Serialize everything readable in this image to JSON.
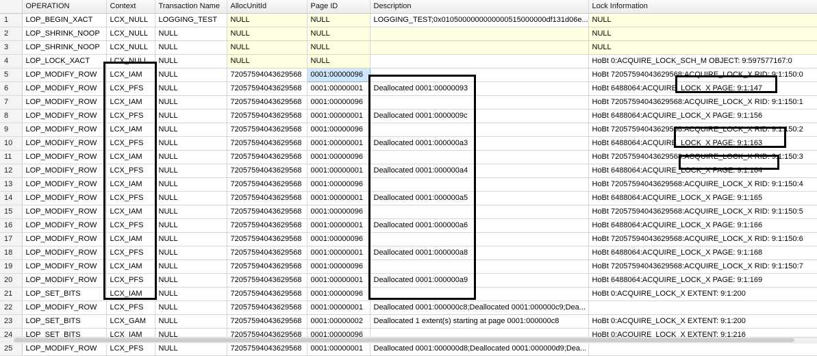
{
  "columns": [
    "",
    "OPERATION",
    "Context",
    "Transaction Name",
    "AllocUnitId",
    "Page ID",
    "Description",
    "Lock Information"
  ],
  "rows": [
    [
      "1",
      "LOP_BEGIN_XACT",
      "LCX_NULL",
      "LOGGING_TEST",
      "NULL",
      "NULL",
      "LOGGING_TEST;0x0105000000000000515000000df131d06e...",
      "NULL"
    ],
    [
      "2",
      "LOP_SHRINK_NOOP",
      "LCX_NULL",
      "NULL",
      "NULL",
      "NULL",
      "",
      "NULL"
    ],
    [
      "3",
      "LOP_SHRINK_NOOP",
      "LCX_NULL",
      "NULL",
      "NULL",
      "NULL",
      "",
      "NULL"
    ],
    [
      "4",
      "LOP_LOCK_XACT",
      "LCX_NULL",
      "NULL",
      "NULL",
      "NULL",
      "",
      "HoBt 0:ACQUIRE_LOCK_SCH_M OBJECT: 9:597577167:0"
    ],
    [
      "5",
      "LOP_MODIFY_ROW",
      "LCX_IAM",
      "NULL",
      "72057594043629568",
      "0001:00000096",
      "",
      "HoBt 72057594043629568:ACQUIRE_LOCK_X RID: 9:1:150:0"
    ],
    [
      "6",
      "LOP_MODIFY_ROW",
      "LCX_PFS",
      "NULL",
      "72057594043629568",
      "0001:00000001",
      "Deallocated 0001:00000093",
      "HoBt 6488064:ACQUIRE_LOCK_X PAGE: 9:1:147"
    ],
    [
      "7",
      "LOP_MODIFY_ROW",
      "LCX_IAM",
      "NULL",
      "72057594043629568",
      "0001:00000096",
      "",
      "HoBt 72057594043629568:ACQUIRE_LOCK_X RID: 9:1:150:1"
    ],
    [
      "8",
      "LOP_MODIFY_ROW",
      "LCX_PFS",
      "NULL",
      "72057594043629568",
      "0001:00000001",
      "Deallocated 0001:0000009c",
      "HoBt 6488064:ACQUIRE_LOCK_X PAGE: 9:1:156"
    ],
    [
      "9",
      "LOP_MODIFY_ROW",
      "LCX_IAM",
      "NULL",
      "72057594043629568",
      "0001:00000096",
      "",
      "HoBt 72057594043629568:ACQUIRE_LOCK_X RID: 9:1:150:2"
    ],
    [
      "10",
      "LOP_MODIFY_ROW",
      "LCX_PFS",
      "NULL",
      "72057594043629568",
      "0001:00000001",
      "Deallocated 0001:000000a3",
      "HoBt 6488064:ACQUIRE_LOCK_X PAGE: 9:1:163"
    ],
    [
      "11",
      "LOP_MODIFY_ROW",
      "LCX_IAM",
      "NULL",
      "72057594043629568",
      "0001:00000096",
      "",
      "HoBt 72057594043629568:ACQUIRE_LOCK_X RID: 9:1:150:3"
    ],
    [
      "12",
      "LOP_MODIFY_ROW",
      "LCX_PFS",
      "NULL",
      "72057594043629568",
      "0001:00000001",
      "Deallocated 0001:000000a4",
      "HoBt 6488064:ACQUIRE_LOCK_X PAGE: 9:1:164"
    ],
    [
      "13",
      "LOP_MODIFY_ROW",
      "LCX_IAM",
      "NULL",
      "72057594043629568",
      "0001:00000096",
      "",
      "HoBt 72057594043629568:ACQUIRE_LOCK_X RID: 9:1:150:4"
    ],
    [
      "14",
      "LOP_MODIFY_ROW",
      "LCX_PFS",
      "NULL",
      "72057594043629568",
      "0001:00000001",
      "Deallocated 0001:000000a5",
      "HoBt 6488064:ACQUIRE_LOCK_X PAGE: 9:1:165"
    ],
    [
      "15",
      "LOP_MODIFY_ROW",
      "LCX_IAM",
      "NULL",
      "72057594043629568",
      "0001:00000096",
      "",
      "HoBt 72057594043629568:ACQUIRE_LOCK_X RID: 9:1:150:5"
    ],
    [
      "16",
      "LOP_MODIFY_ROW",
      "LCX_PFS",
      "NULL",
      "72057594043629568",
      "0001:00000001",
      "Deallocated 0001:000000a6",
      "HoBt 6488064:ACQUIRE_LOCK_X PAGE: 9:1:166"
    ],
    [
      "17",
      "LOP_MODIFY_ROW",
      "LCX_IAM",
      "NULL",
      "72057594043629568",
      "0001:00000096",
      "",
      "HoBt 72057594043629568:ACQUIRE_LOCK_X RID: 9:1:150:6"
    ],
    [
      "18",
      "LOP_MODIFY_ROW",
      "LCX_PFS",
      "NULL",
      "72057594043629568",
      "0001:00000001",
      "Deallocated 0001:000000a8",
      "HoBt 6488064:ACQUIRE_LOCK_X PAGE: 9:1:168"
    ],
    [
      "19",
      "LOP_MODIFY_ROW",
      "LCX_IAM",
      "NULL",
      "72057594043629568",
      "0001:00000096",
      "",
      "HoBt 72057594043629568:ACQUIRE_LOCK_X RID: 9:1:150:7"
    ],
    [
      "20",
      "LOP_MODIFY_ROW",
      "LCX_PFS",
      "NULL",
      "72057594043629568",
      "0001:00000001",
      "Deallocated 0001:000000a9",
      "HoBt 6488064:ACQUIRE_LOCK_X PAGE: 9:1:169"
    ],
    [
      "21",
      "LOP_SET_BITS",
      "LCX_IAM",
      "NULL",
      "72057594043629568",
      "0001:00000096",
      "",
      "HoBt 0:ACQUIRE_LOCK_X EXTENT: 9:1:200"
    ],
    [
      "22",
      "LOP_MODIFY_ROW",
      "LCX_PFS",
      "NULL",
      "72057594043629568",
      "0001:00000001",
      "Deallocated 0001:000000c8;Deallocated 0001:000000c9;Dea...",
      ""
    ],
    [
      "23",
      "LOP_SET_BITS",
      "LCX_GAM",
      "NULL",
      "72057594043629568",
      "0001:00000002",
      "Deallocated 1 extent(s) starting at page 0001:000000c8",
      "HoBt 0:ACQUIRE_LOCK_X EXTENT: 9:1:200"
    ],
    [
      "24",
      "LOP_SET_BITS",
      "LCX_IAM",
      "NULL",
      "72057594043629568",
      "0001:00000096",
      "",
      "HoBt 0:ACQUIRE_LOCK_X EXTENT: 9:1:216"
    ],
    [
      "25",
      "LOP_MODIFY_ROW",
      "LCX_PFS",
      "NULL",
      "72057594043629568",
      "0001:00000001",
      "Deallocated 0001:000000d8;Deallocated 0001:000000d9;Dea...",
      ""
    ]
  ],
  "selected_cell": {
    "row": 5,
    "column": "Page ID"
  },
  "colors": {
    "null_cell": "#ffffe1",
    "selected_cell": "#cfe7fb",
    "header": "#ececec",
    "highlight_border": "#000000"
  }
}
